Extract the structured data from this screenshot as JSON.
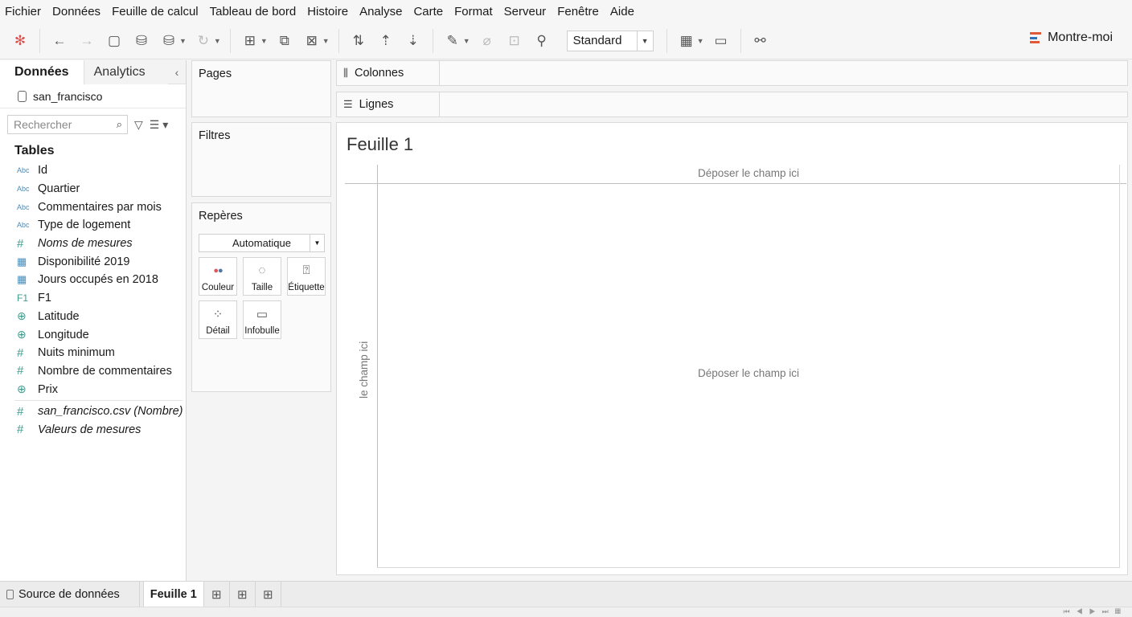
{
  "menu": [
    "Fichier",
    "Données",
    "Feuille de calcul",
    "Tableau de bord",
    "Histoire",
    "Analyse",
    "Carte",
    "Format",
    "Serveur",
    "Fenêtre",
    "Aide"
  ],
  "toolbar": {
    "fit_select": "Standard",
    "show_me": "Montre-moi"
  },
  "datapane": {
    "tab_data": "Données",
    "tab_analytics": "Analytics",
    "datasource": "san_francisco",
    "search_placeholder": "Rechercher",
    "tables_heading": "Tables",
    "fields": [
      {
        "name": "Id",
        "type": "Abc"
      },
      {
        "name": "Quartier",
        "type": "Abc"
      },
      {
        "name": "Commentaires par mois",
        "type": "Abc"
      },
      {
        "name": "Type de logement",
        "type": "Abc"
      },
      {
        "name": "Noms de mesures",
        "type": "#"
      },
      {
        "name": "Disponibilité 2019",
        "type": "grid"
      },
      {
        "name": "Jours occupés en 2018",
        "type": "grid"
      },
      {
        "name": "F1",
        "type": "F1"
      },
      {
        "name": "Latitude",
        "type": "globe"
      },
      {
        "name": "Longitude",
        "type": "globe"
      },
      {
        "name": "Nuits minimum",
        "type": "#"
      },
      {
        "name": "Nombre de commentaires",
        "type": "#"
      },
      {
        "name": "Prix",
        "type": "globe"
      }
    ],
    "measure_fields": [
      {
        "name": "san_francisco.csv (Nombre)",
        "type": "#"
      },
      {
        "name": "Valeurs de mesures",
        "type": "#"
      }
    ]
  },
  "cards": {
    "pages": "Pages",
    "filters": "Filtres",
    "marks": "Repères",
    "marks_type": "Automatique",
    "marks_buttons": [
      "Couleur",
      "Taille",
      "Étiquette",
      "Détail",
      "Infobulle"
    ]
  },
  "shelves": {
    "columns": "Colonnes",
    "rows": "Lignes"
  },
  "view": {
    "sheet_title": "Feuille 1",
    "drop_top": "Déposer le champ ici",
    "drop_center": "Déposer le champ ici",
    "drop_left": "le champ ici"
  },
  "bottom": {
    "datasource_tab": "Source de données",
    "sheet_tab": "Feuille 1"
  }
}
